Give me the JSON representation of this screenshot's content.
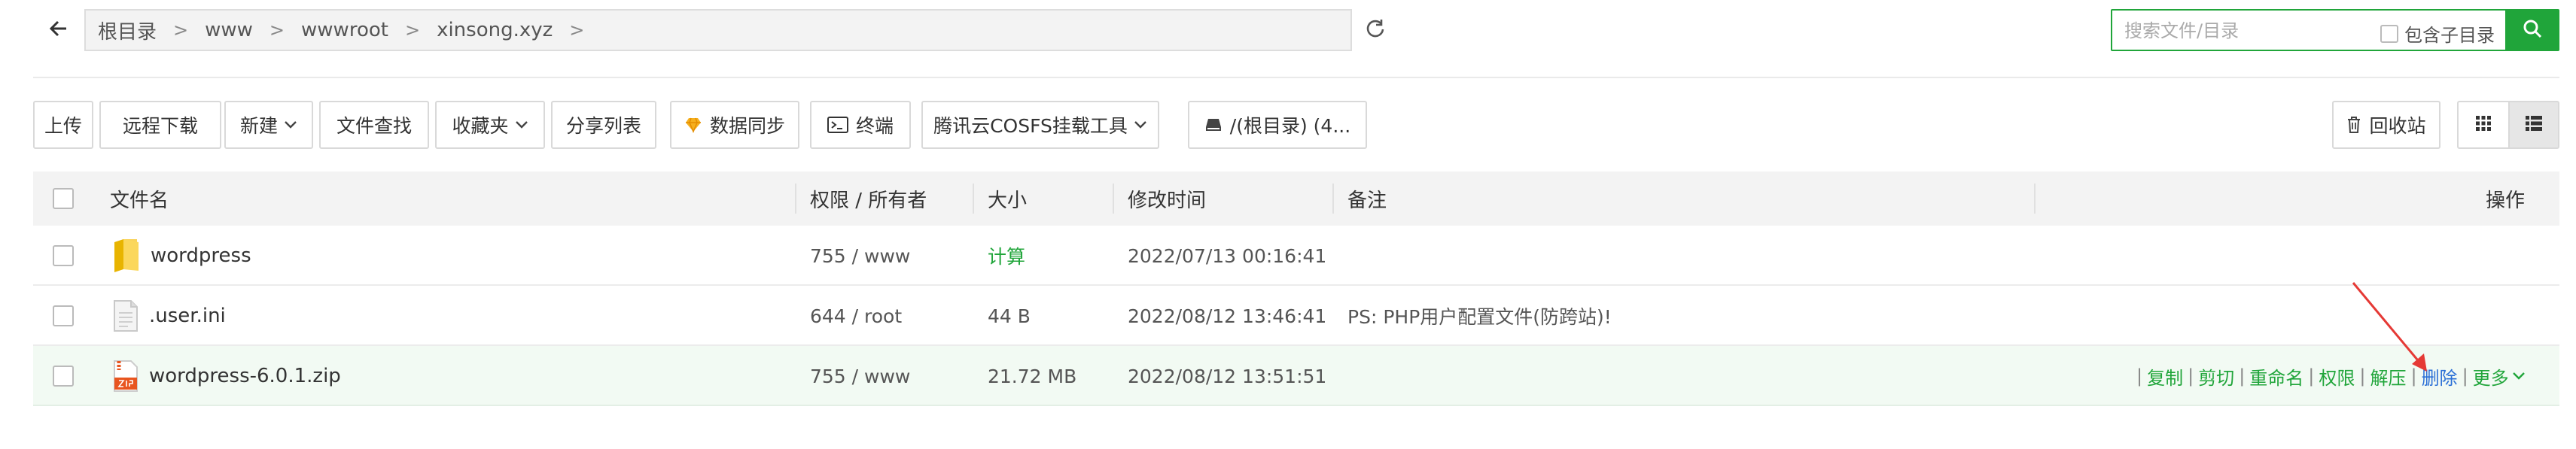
{
  "breadcrumb": {
    "items": [
      "根目录",
      "www",
      "wwwroot",
      "xinsong.xyz"
    ]
  },
  "search": {
    "placeholder": "搜索文件/目录",
    "include_subdirs_label": "包含子目录"
  },
  "toolbar": {
    "upload": "上传",
    "remote_download": "远程下载",
    "new": "新建",
    "file_search": "文件查找",
    "favorites": "收藏夹",
    "share_list": "分享列表",
    "data_sync": "数据同步",
    "terminal": "终端",
    "cosfs": "腾讯云COSFS挂载工具",
    "disk": "/(根目录) (4...",
    "recycle_bin": "回收站"
  },
  "table": {
    "headers": {
      "name": "文件名",
      "perm_owner": "权限 / 所有者",
      "size": "大小",
      "mtime": "修改时间",
      "note": "备注",
      "ops": "操作"
    },
    "rows": [
      {
        "name": "wordpress",
        "type": "folder-icon",
        "perm": "755 / www",
        "size": "计算",
        "mtime": "2022/07/13 00:16:41",
        "note": ""
      },
      {
        "name": ".user.ini",
        "type": "file-icon",
        "perm": "644 / root",
        "size": "44 B",
        "mtime": "2022/08/12 13:46:41",
        "note": "PS: PHP用户配置文件(防跨站)!"
      },
      {
        "name": "wordpress-6.0.1.zip",
        "type": "zip-file-icon",
        "perm": "755 / www",
        "size": "21.72 MB",
        "mtime": "2022/08/12 13:51:51",
        "note": ""
      }
    ],
    "row_actions": {
      "copy": "复制",
      "cut": "剪切",
      "rename": "重命名",
      "permission": "权限",
      "extract": "解压",
      "delete": "删除",
      "more": "更多"
    }
  },
  "colors": {
    "accent": "#20a53a",
    "delete_link": "#2a6fd6",
    "arrow": "#e53935"
  }
}
